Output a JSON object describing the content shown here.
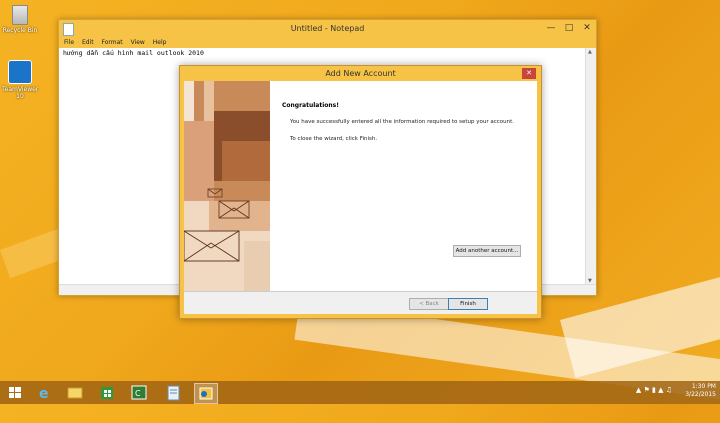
{
  "desktop": {
    "icons": [
      {
        "label": "Recycle Bin",
        "icon": "recycle-bin-icon"
      },
      {
        "label": "TeamViewer 10",
        "icon": "teamviewer-icon"
      }
    ]
  },
  "notepad": {
    "title": "Untitled - Notepad",
    "menu": [
      "File",
      "Edit",
      "Format",
      "View",
      "Help"
    ],
    "content": "hướng dẫn cấu hình mail outlook 2010"
  },
  "dialog": {
    "title": "Add New Account",
    "heading": "Congratulations!",
    "message1": "You have successfully entered all the information required to setup your account.",
    "message2": "To close the wizard, click Finish.",
    "add_another_label": "Add another account...",
    "back_label": "< Back",
    "finish_label": "Finish"
  },
  "taskbar": {
    "items": [
      "start-icon",
      "internet-explorer-icon",
      "file-explorer-icon",
      "store-icon",
      "camtasia-icon",
      "notepad-icon",
      "outlook-icon"
    ],
    "time": "1:30 PM",
    "date": "3/22/2015"
  },
  "colors": {
    "desktop": "#f0a81c",
    "window_title": "#f7c346",
    "close_button": "#c8453a"
  }
}
